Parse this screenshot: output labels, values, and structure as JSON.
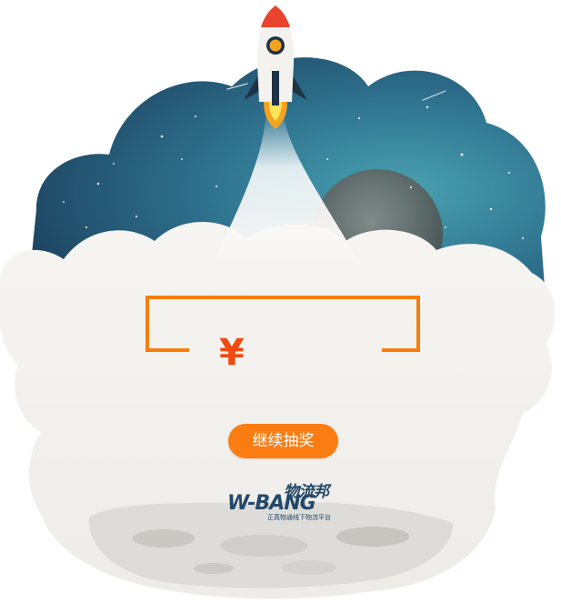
{
  "prize": {
    "currency_symbol": "¥",
    "amount": ""
  },
  "actions": {
    "continue_label": "继续抽奖"
  },
  "brand": {
    "name_cn": "物流邦",
    "name_en": "W-BANG",
    "tagline": "正真物通线下物流平台"
  },
  "colors": {
    "accent_orange": "#fb7d12",
    "frame_orange": "#f77e0b",
    "yen_red": "#ef4a12",
    "sky_dark": "#1f4a66",
    "sky_light": "#3c8fa3",
    "cloud": "#f3f1ee",
    "logo_navy": "#23486a"
  },
  "icons": [
    "rocket-icon",
    "moon-icon",
    "star-icon",
    "shooting-star-icon",
    "yen-icon"
  ]
}
